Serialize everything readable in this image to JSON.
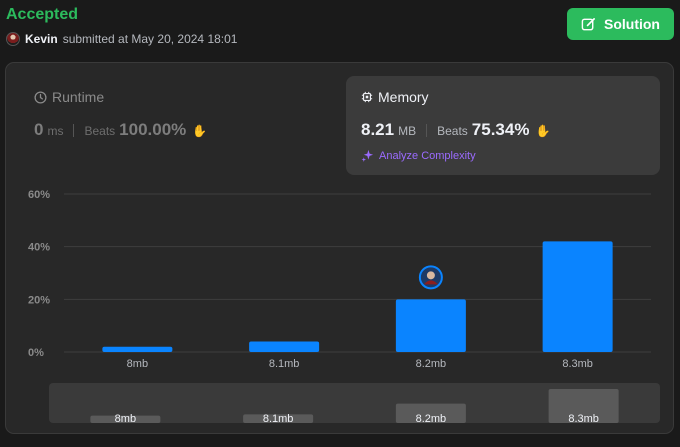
{
  "header": {
    "status": "Accepted",
    "username": "Kevin",
    "submitted_text": "submitted at May 20, 2024 18:01"
  },
  "solution_button": {
    "label": "Solution",
    "icon": "edit-icon"
  },
  "runtime": {
    "title": "Runtime",
    "icon": "clock-icon",
    "value": "0",
    "unit": "ms",
    "beats_label": "Beats",
    "beats_value": "100.00%"
  },
  "memory": {
    "title": "Memory",
    "icon": "chip-icon",
    "value": "8.21",
    "unit": "MB",
    "beats_label": "Beats",
    "beats_value": "75.34%"
  },
  "analyze": {
    "label": "Analyze Complexity",
    "icon": "sparkle-icon"
  },
  "colors": {
    "accent_green": "#2cbb5d",
    "bar_blue": "#0a84ff",
    "analyze_purple": "#9b6bff"
  },
  "chart_data": {
    "type": "bar",
    "categories": [
      "8mb",
      "8.1mb",
      "8.2mb",
      "8.3mb"
    ],
    "values": [
      2,
      4,
      20,
      42
    ],
    "ylim": [
      0,
      60
    ],
    "yticks": [
      "0%",
      "20%",
      "40%",
      "60%"
    ],
    "ytick_values": [
      0,
      20,
      40,
      60
    ],
    "grid": true,
    "highlight_category": "8.2mb",
    "overview": {
      "categories": [
        "8mb",
        "8.1mb",
        "8.2mb",
        "8.3mb"
      ],
      "values": [
        2,
        4,
        20,
        42
      ]
    }
  }
}
